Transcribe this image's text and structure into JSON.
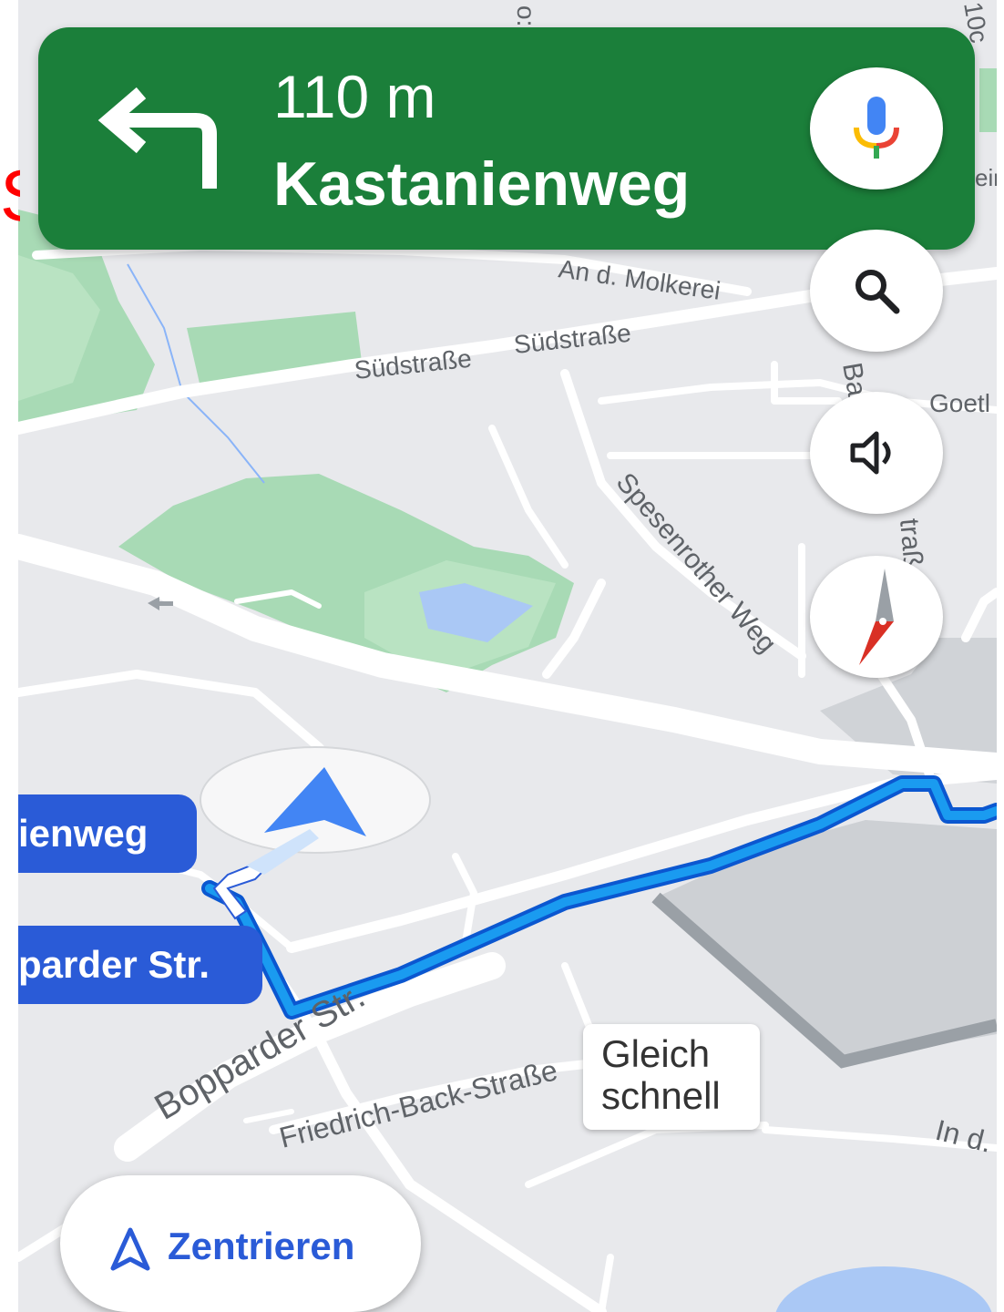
{
  "navigation": {
    "distance": "110 m",
    "street": "Kastanienweg",
    "maneuver_icon": "turn-left-icon"
  },
  "side_buttons": [
    {
      "name": "voice-search-button",
      "icon": "microphone-icon"
    },
    {
      "name": "search-button",
      "icon": "search-icon"
    },
    {
      "name": "sound-button",
      "icon": "speaker-icon"
    },
    {
      "name": "compass-button",
      "icon": "compass-icon"
    }
  ],
  "route_labels": {
    "current": "ienweg",
    "next": "parder Str."
  },
  "callout": {
    "line1": "Gleich",
    "line2": "schnell"
  },
  "recenter": {
    "label": "Zentrieren",
    "icon": "navigation-arrow-icon"
  },
  "map_labels": {
    "molkerei": "An d. Molkerei",
    "suedstrasse_1": "Südstraße",
    "suedstrasse_2": "Südstraße",
    "spesenrother": "Spesenrother Weg",
    "goethe": "Goetl",
    "bopparder": "Bopparder Str.",
    "friedrich_back": "Friedrich-Back-Straße",
    "in_d": "In d.",
    "bahnhof_fragment_1": "Ba",
    "bahnhof_fragment_2": "traß",
    "top_fragment_1": "o:",
    "top_fragment_2": "10c",
    "top_fragment_3": "eir"
  },
  "colors": {
    "banner_green": "#1b7f3a",
    "route_blue": "#1a73e8",
    "label_blue": "#2a5bd7",
    "park_green": "#a8dab5",
    "water_blue": "#aac8f5",
    "map_background": "#e8e9ec"
  }
}
